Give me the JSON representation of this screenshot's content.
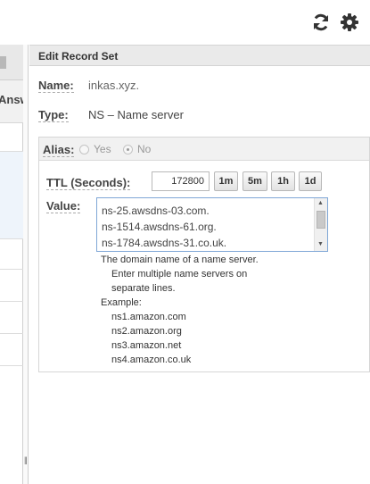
{
  "toolbar": {
    "icons": [
      "refresh-icon",
      "gear-icon"
    ]
  },
  "left_panel": {
    "column_header_partial": "Answ"
  },
  "edit_panel": {
    "title": "Edit Record Set",
    "name_label": "Name:",
    "name_value": "inkas.xyz.",
    "type_label": "Type:",
    "type_value": "NS – Name server",
    "alias": {
      "label": "Alias:",
      "options": [
        "Yes",
        "No"
      ],
      "selected": "No"
    },
    "ttl": {
      "label": "TTL (Seconds):",
      "value": "172800",
      "buttons": [
        "1m",
        "5m",
        "1h",
        "1d"
      ]
    },
    "value": {
      "label": "Value:",
      "lines": [
        "ns-25.awsdns-03.com.",
        "ns-1514.awsdns-61.org.",
        "ns-1784.awsdns-31.co.uk."
      ],
      "help": [
        "The domain name of a name server.",
        "Enter multiple name servers on",
        "separate lines.",
        "Example:",
        "ns1.amazon.com",
        "ns2.amazon.org",
        "ns3.amazon.net",
        "ns4.amazon.co.uk"
      ]
    }
  }
}
